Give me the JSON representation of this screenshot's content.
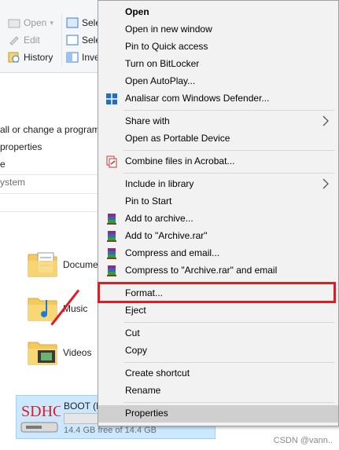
{
  "ribbon": {
    "open": "Open",
    "edit": "Edit",
    "history": "History",
    "select1": "Sele",
    "select2": "Sele",
    "invert": "Inve"
  },
  "left_links": {
    "change_program": "all or change a program",
    "properties": "properties",
    "e": "e",
    "system": "ystem"
  },
  "folders": [
    {
      "label": "Docume"
    },
    {
      "label": "Music"
    },
    {
      "label": "Videos"
    }
  ],
  "drive": {
    "name": "BOOT (D",
    "space": "14.4 GB free of 14.4 GB",
    "badge": "SDHC"
  },
  "context_menu": {
    "open": "Open",
    "open_new_window": "Open in new window",
    "pin_quick": "Pin to Quick access",
    "bitlocker": "Turn on BitLocker",
    "autoplay": "Open AutoPlay...",
    "defender": "Analisar com Windows Defender...",
    "share_with": "Share with",
    "portable": "Open as Portable Device",
    "acrobat": "Combine files in Acrobat...",
    "include_library": "Include in library",
    "pin_start": "Pin to Start",
    "add_archive": "Add to archive...",
    "add_archive_rar": "Add to \"Archive.rar\"",
    "compress_email": "Compress and email...",
    "compress_rar_email": "Compress to \"Archive.rar\" and email",
    "format": "Format...",
    "eject": "Eject",
    "cut": "Cut",
    "copy": "Copy",
    "create_shortcut": "Create shortcut",
    "rename": "Rename",
    "properties": "Properties"
  },
  "watermark": "CSDN @vann..",
  "colors": {
    "highlight": "#e11b22",
    "selection": "#cce8ff"
  }
}
